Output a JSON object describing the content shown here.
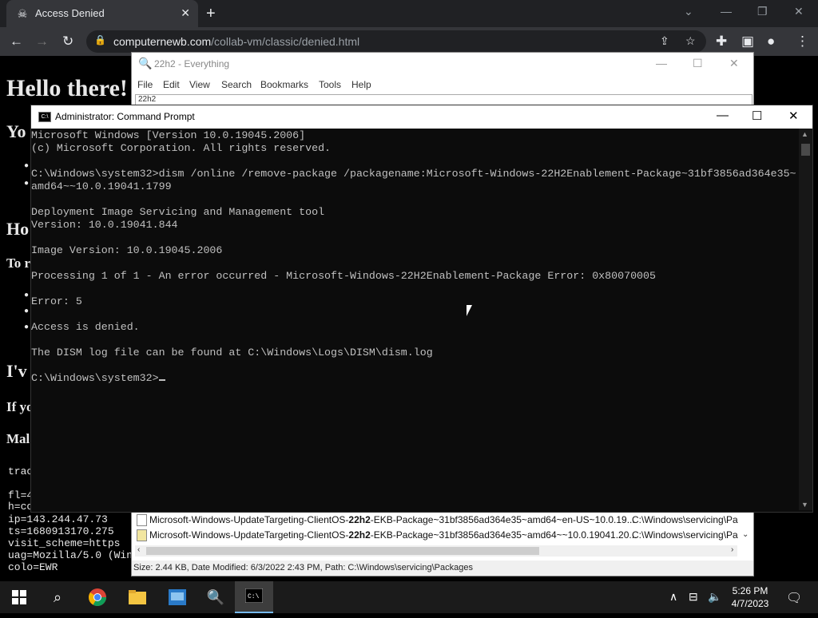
{
  "browser": {
    "tab_title": "Access Denied",
    "tab_close": "✕",
    "new_tab": "+",
    "url_host": "computernewb.com",
    "url_path": "/collab-vm/classic/denied.html"
  },
  "page": {
    "heading": "Hello there!",
    "partial_lines": [
      "Yo",
      "Ho",
      "To r",
      "I'v",
      "If yo",
      "Mal"
    ],
    "mono_lines": [
      "trac",
      "",
      "fl=4",
      "h=co",
      "ip=143.244.47.73",
      "ts=1680913170.275",
      "visit_scheme=https",
      "uag=Mozilla/5.0 (Wind",
      "colo=EWR"
    ]
  },
  "everything": {
    "title": "22h2 - Everything",
    "menu": [
      "File",
      "Edit",
      "View",
      "Search",
      "Bookmarks",
      "Tools",
      "Help"
    ],
    "search_value": "22h2",
    "rows": [
      {
        "name_pre": "Microsoft-Windows-UpdateTargeting-ClientOS-",
        "name_bold": "22h2",
        "name_post": "-EKB-Package~31bf3856ad364e35~amd64~en-US~10.0.19...",
        "path": "C:\\Windows\\servicing\\Pa"
      },
      {
        "name_pre": "Microsoft-Windows-UpdateTargeting-ClientOS-",
        "name_bold": "22h2",
        "name_post": "-EKB-Package~31bf3856ad364e35~amd64~~10.0.19041.20...",
        "path": "C:\\Windows\\servicing\\Pa"
      }
    ],
    "status": "Size: 2.44 KB, Date Modified: 6/3/2022 2:43 PM, Path: C:\\Windows\\servicing\\Packages"
  },
  "cmd": {
    "title": "Administrator: Command Prompt",
    "icon_label": "C:\\",
    "lines": [
      "Microsoft Windows [Version 10.0.19045.2006]",
      "(c) Microsoft Corporation. All rights reserved.",
      "",
      "C:\\Windows\\system32>dism /online /remove-package /packagename:Microsoft-Windows-22H2Enablement-Package~31bf3856ad364e35~",
      "amd64~~10.0.19041.1799",
      "",
      "Deployment Image Servicing and Management tool",
      "Version: 10.0.19041.844",
      "",
      "Image Version: 10.0.19045.2006",
      "",
      "Processing 1 of 1 - An error occurred - Microsoft-Windows-22H2Enablement-Package Error: 0x80070005",
      "",
      "Error: 5",
      "",
      "Access is denied.",
      "",
      "The DISM log file can be found at C:\\Windows\\Logs\\DISM\\dism.log",
      "",
      "C:\\Windows\\system32>"
    ]
  },
  "taskbar": {
    "time": "5:26 PM",
    "date": "4/7/2023"
  },
  "icons": {
    "start": "windows-start-icon",
    "search": "search-icon",
    "chrome": "chrome-icon",
    "explorer": "file-explorer-icon",
    "control_panel": "control-panel-icon",
    "everything": "everything-search-icon",
    "cmd": "command-prompt-icon"
  },
  "colors": {
    "cmd_bg": "#0c0c0c",
    "cmd_fg": "#c0c0c0",
    "chrome_dark": "#202124",
    "taskbar": "#1b1b1b"
  }
}
